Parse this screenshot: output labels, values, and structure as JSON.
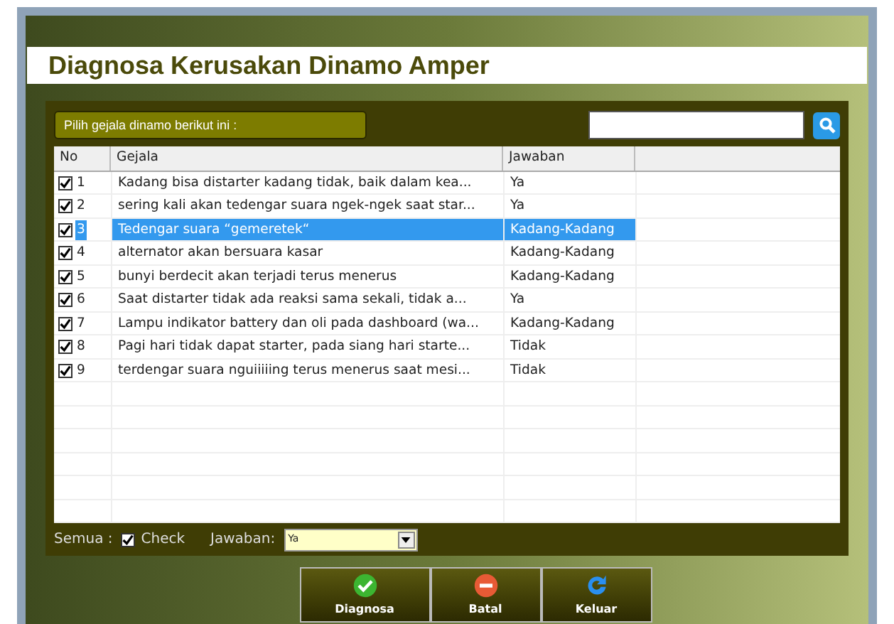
{
  "title": "Diagnosa Kerusakan Dinamo Amper",
  "prompt": "Pilih gejala dinamo berikut ini :",
  "search": {
    "kind": "text"
  },
  "table": {
    "columns": [
      "No",
      "Gejala",
      "Jawaban"
    ],
    "rows": [
      {
        "checked": true,
        "no": "1",
        "gejala": "Kadang bisa distarter kadang tidak, baik dalam kea...",
        "jawaban": "Ya",
        "selected": false
      },
      {
        "checked": true,
        "no": "2",
        "gejala": "sering kali akan tedengar suara ngek-ngek saat star...",
        "jawaban": "Ya",
        "selected": false
      },
      {
        "checked": true,
        "no": "3",
        "gejala": "Tedengar suara “gemeretek“",
        "jawaban": "Kadang-Kadang",
        "selected": true
      },
      {
        "checked": true,
        "no": "4",
        "gejala": "alternator akan bersuara kasar",
        "jawaban": "Kadang-Kadang",
        "selected": false
      },
      {
        "checked": true,
        "no": "5",
        "gejala": "bunyi berdecit akan terjadi terus menerus",
        "jawaban": "Kadang-Kadang",
        "selected": false
      },
      {
        "checked": true,
        "no": "6",
        "gejala": "Saat distarter tidak ada reaksi sama sekali, tidak a...",
        "jawaban": "Ya",
        "selected": false
      },
      {
        "checked": true,
        "no": "7",
        "gejala": "Lampu indikator battery dan oli pada dashboard (wa...",
        "jawaban": "Kadang-Kadang",
        "selected": false
      },
      {
        "checked": true,
        "no": "8",
        "gejala": "Pagi hari tidak dapat starter, pada siang hari starte...",
        "jawaban": "Tidak",
        "selected": false
      },
      {
        "checked": true,
        "no": "9",
        "gejala": "terdengar suara nguiiiiing terus menerus saat mesi...",
        "jawaban": "Tidak",
        "selected": false
      }
    ]
  },
  "footer": {
    "semua_label": "Semua :",
    "check_all": {
      "label": "Check",
      "checked": true
    },
    "jawaban_label": "Jawaban:",
    "jawaban_value": "Ya"
  },
  "buttons": [
    {
      "label": "Diagnosa",
      "kind": "check"
    },
    {
      "label": "Batal",
      "kind": "cancel"
    },
    {
      "label": "Keluar",
      "kind": "refresh"
    }
  ]
}
